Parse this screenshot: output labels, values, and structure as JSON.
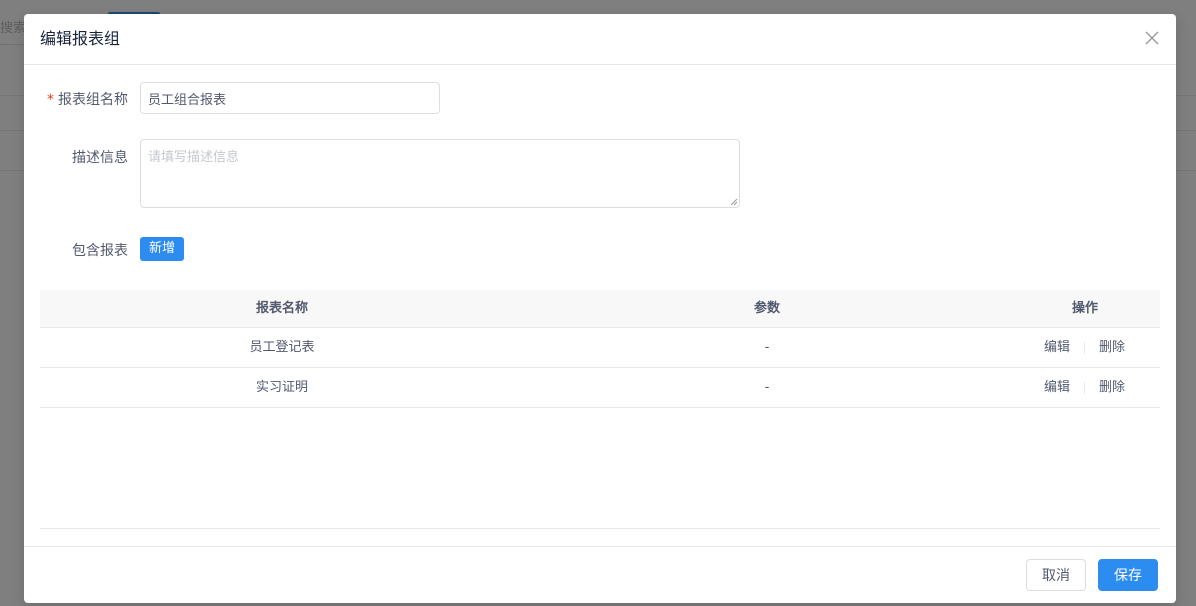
{
  "background": {
    "search_placeholder": "搜索"
  },
  "modal": {
    "title": "编辑报表组",
    "form": {
      "name_label": "报表组名称",
      "required_mark": "*",
      "name_value": "员工组合报表",
      "desc_label": "描述信息",
      "desc_placeholder": "请填写描述信息",
      "reports_label": "包含报表",
      "add_button": "新增"
    },
    "table": {
      "columns": [
        "报表名称",
        "参数",
        "操作"
      ],
      "rows": [
        {
          "name": "员工登记表",
          "params": "-",
          "edit": "编辑",
          "delete": "删除"
        },
        {
          "name": "实习证明",
          "params": "-",
          "edit": "编辑",
          "delete": "删除"
        }
      ]
    },
    "footer": {
      "cancel": "取消",
      "save": "保存"
    }
  },
  "colors": {
    "primary": "#2d8cf0",
    "required": "#ed4014",
    "text": "#515a6e"
  },
  "icons": {
    "close": "close-icon"
  }
}
